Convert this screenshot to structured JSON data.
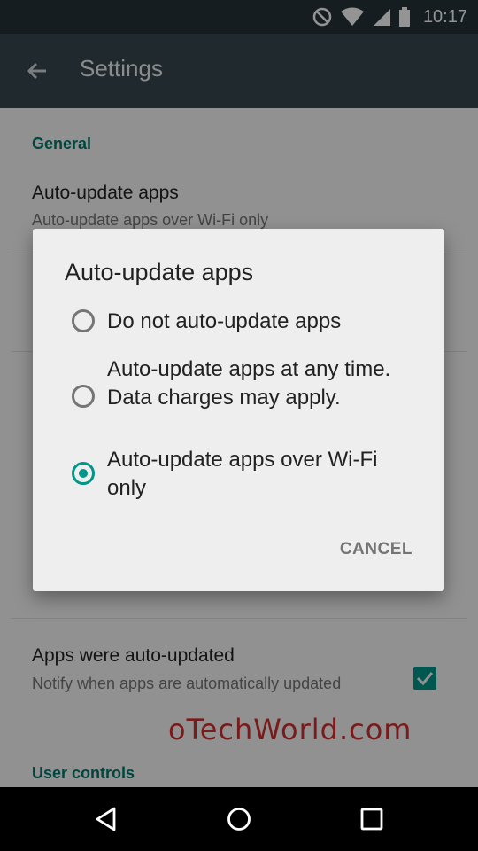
{
  "status_bar": {
    "time": "10:17",
    "icons": [
      "do-not-disturb-icon",
      "wifi-icon",
      "signal-icon",
      "battery-icon"
    ]
  },
  "app_bar": {
    "title": "Settings",
    "back_icon": "arrow-back-icon"
  },
  "settings": {
    "general_header": "General",
    "auto_update": {
      "title": "Auto-update apps",
      "summary": "Auto-update apps over Wi-Fi only"
    },
    "auto_updated": {
      "title": "Apps were auto-updated",
      "summary": "Notify when apps are automatically updated",
      "checked": true
    },
    "user_controls_header": "User controls"
  },
  "dialog": {
    "title": "Auto-update apps",
    "options": [
      {
        "label": "Do not auto-update apps",
        "selected": false
      },
      {
        "label": "Auto-update apps at any time. Data charges may apply.",
        "selected": false
      },
      {
        "label": "Auto-update apps over Wi-Fi only",
        "selected": true
      }
    ],
    "cancel_label": "CANCEL"
  },
  "watermark": "oTechWorld.com",
  "nav_bar": {
    "icons": [
      "back-triangle-icon",
      "home-circle-icon",
      "recents-square-icon"
    ]
  },
  "colors": {
    "accent": "#009688",
    "app_bar": "#37474f",
    "status_bar": "#263238"
  }
}
